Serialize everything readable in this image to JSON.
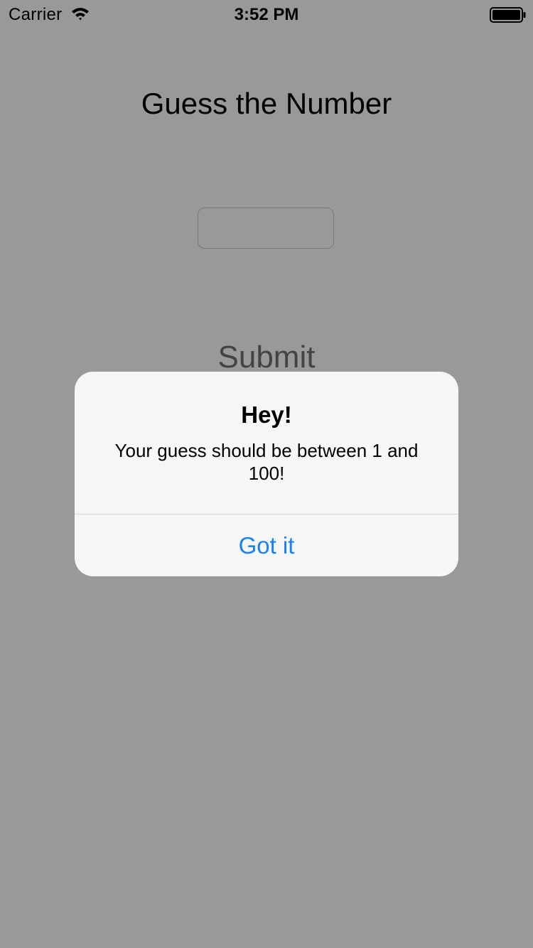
{
  "status_bar": {
    "carrier": "Carrier",
    "time": "3:52 PM",
    "wifi_icon": "wifi-icon",
    "battery_icon": "battery-icon"
  },
  "main": {
    "title": "Guess the Number",
    "guess_input": {
      "value": "",
      "placeholder": ""
    },
    "submit_label": "Submit"
  },
  "alert": {
    "title": "Hey!",
    "message": "Your guess should be between 1 and 100!",
    "button_label": "Got it"
  },
  "colors": {
    "alert_button": "#1a82f0",
    "overlay": "rgba(0,0,0,0.4)",
    "alert_background": "#f6f6f6"
  }
}
